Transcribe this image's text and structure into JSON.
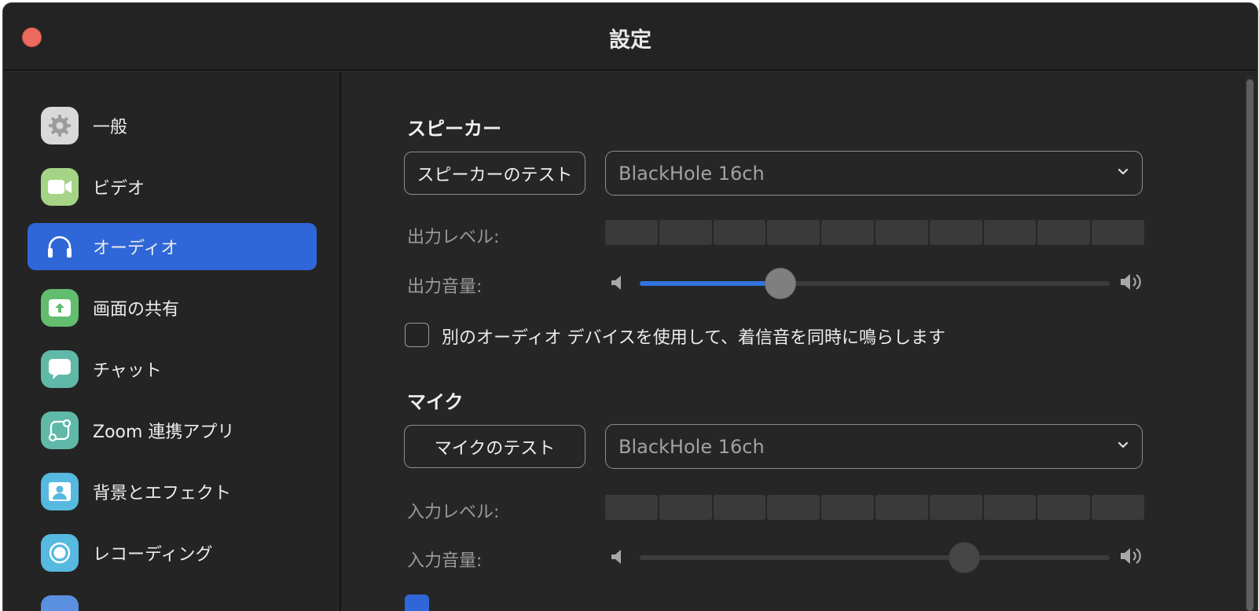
{
  "window": {
    "title": "設定"
  },
  "sidebar": {
    "items": [
      {
        "label": "一般",
        "icon": "gear-icon",
        "color": "#d6d6d6",
        "active": false
      },
      {
        "label": "ビデオ",
        "icon": "video-camera-icon",
        "color": "#9fd27b",
        "active": false
      },
      {
        "label": "オーディオ",
        "icon": "headphones-icon",
        "color": "#2f67d8",
        "active": true
      },
      {
        "label": "画面の共有",
        "icon": "share-screen-icon",
        "color": "#5fbd6b",
        "active": false
      },
      {
        "label": "チャット",
        "icon": "chat-bubble-icon",
        "color": "#5fb7a6",
        "active": false
      },
      {
        "label": "Zoom 連携アプリ",
        "icon": "apps-icon",
        "color": "#5fb7a6",
        "active": false
      },
      {
        "label": "背景とエフェクト",
        "icon": "background-icon",
        "color": "#54b7de",
        "active": false
      },
      {
        "label": "レコーディング",
        "icon": "record-icon",
        "color": "#54b7de",
        "active": false
      }
    ]
  },
  "speaker": {
    "heading": "スピーカー",
    "test_button": "スピーカーのテスト",
    "device": "BlackHole 16ch",
    "output_level_label": "出力レベル:",
    "output_volume_label": "出力音量:",
    "volume_fraction": 0.3,
    "ring_checkbox_label": "別のオーディオ デバイスを使用して、着信音を同時に鳴らします",
    "ring_checked": false
  },
  "mic": {
    "heading": "マイク",
    "test_button": "マイクのテスト",
    "device": "BlackHole 16ch",
    "input_level_label": "入力レベル:",
    "input_volume_label": "入力音量:",
    "volume_fraction": 0.69
  },
  "colors": {
    "accent": "#2f67d8",
    "close_button": "#ec6a5e",
    "window_bg": "#262626"
  }
}
